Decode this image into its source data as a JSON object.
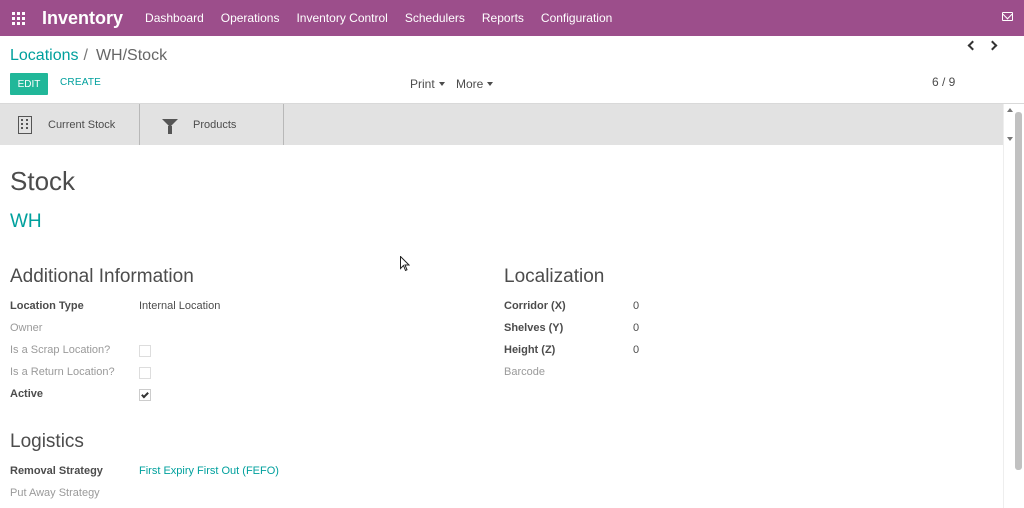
{
  "navbar": {
    "app_name": "Inventory",
    "menu": [
      "Dashboard",
      "Operations",
      "Inventory Control",
      "Schedulers",
      "Reports",
      "Configuration"
    ]
  },
  "control_panel": {
    "breadcrumb_parent": "Locations",
    "breadcrumb_separator": "/",
    "breadcrumb_current": "WH/Stock",
    "edit_label": "EDIT",
    "create_label": "CREATE",
    "print_label": "Print",
    "more_label": "More",
    "pager": "6 / 9"
  },
  "button_box": {
    "current_stock_label": "Current Stock",
    "products_label": "Products"
  },
  "form": {
    "name": "Stock",
    "parent": "WH",
    "additional_info": {
      "title": "Additional Information",
      "location_type_label": "Location Type",
      "location_type_value": "Internal Location",
      "owner_label": "Owner",
      "scrap_label": "Is a Scrap Location?",
      "scrap_checked": false,
      "return_label": "Is a Return Location?",
      "return_checked": false,
      "active_label": "Active",
      "active_checked": true
    },
    "localization": {
      "title": "Localization",
      "corridor_label": "Corridor (X)",
      "corridor_value": "0",
      "shelves_label": "Shelves (Y)",
      "shelves_value": "0",
      "height_label": "Height (Z)",
      "height_value": "0",
      "barcode_label": "Barcode"
    },
    "logistics": {
      "title": "Logistics",
      "removal_label": "Removal Strategy",
      "removal_value": "First Expiry First Out (FEFO)",
      "putaway_label": "Put Away Strategy"
    }
  },
  "colors": {
    "navbar": "#9c4e8b",
    "accent": "#00a09d",
    "edit_button": "#21b799"
  }
}
